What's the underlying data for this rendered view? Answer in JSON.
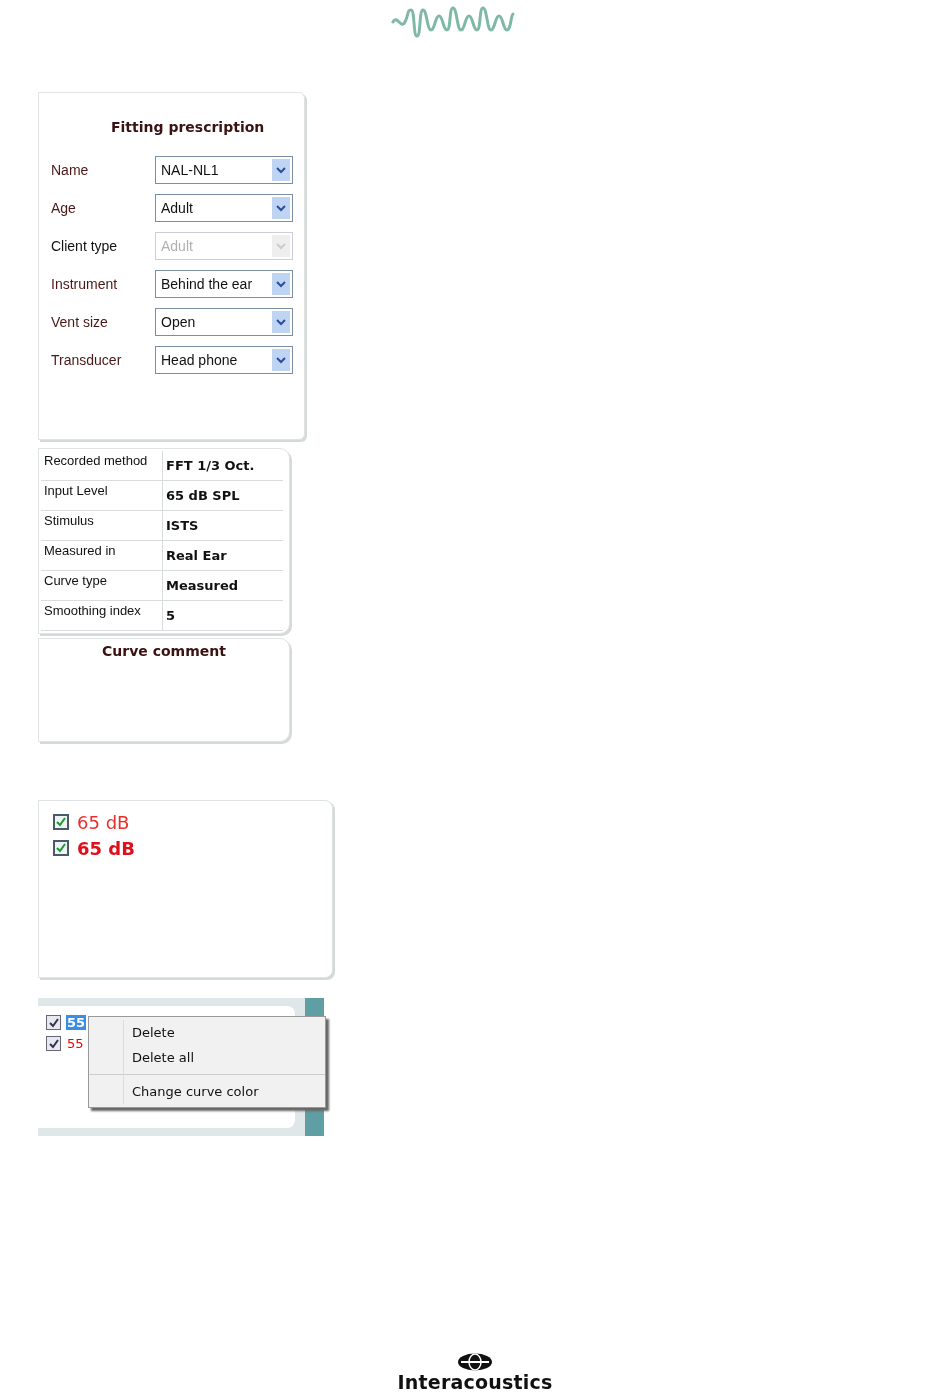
{
  "fitting_prescription": {
    "title": "Fitting prescription",
    "fields": [
      {
        "label": "Name",
        "value": "NAL-NL1",
        "disabled": false
      },
      {
        "label": "Age",
        "value": "Adult",
        "disabled": false
      },
      {
        "label": "Client type",
        "value": "Adult",
        "disabled": true
      },
      {
        "label": "Instrument",
        "value": "Behind the ear",
        "disabled": false
      },
      {
        "label": "Vent size",
        "value": "Open",
        "disabled": false
      },
      {
        "label": "Transducer",
        "value": "Head phone",
        "disabled": false
      }
    ]
  },
  "measurement_info": {
    "rows": [
      {
        "label": "Recorded method",
        "value": "FFT 1/3 Oct."
      },
      {
        "label": "Input Level",
        "value": "65 dB SPL"
      },
      {
        "label": "Stimulus",
        "value": "ISTS"
      },
      {
        "label": "Measured in",
        "value": "Real Ear"
      },
      {
        "label": "Curve type",
        "value": "Measured"
      },
      {
        "label": "Smoothing index",
        "value": "5"
      }
    ]
  },
  "curve_comment": {
    "title": "Curve comment"
  },
  "curve_list": {
    "items": [
      {
        "label": "65 dB",
        "checked": true,
        "bold": false,
        "color": "#e8312f"
      },
      {
        "label": "65 dB",
        "checked": true,
        "bold": true,
        "color": "#e0101a"
      }
    ]
  },
  "curve_list_menu": {
    "items": [
      {
        "label": "55",
        "checked": true,
        "selected": true
      },
      {
        "label": "55",
        "checked": true,
        "selected": false
      }
    ],
    "context_menu": [
      {
        "label": "Delete",
        "separator_before": false
      },
      {
        "label": "Delete all",
        "separator_before": false
      },
      {
        "label": "Change curve color",
        "separator_before": true
      }
    ]
  },
  "footer": {
    "brand": "Interacoustics"
  }
}
